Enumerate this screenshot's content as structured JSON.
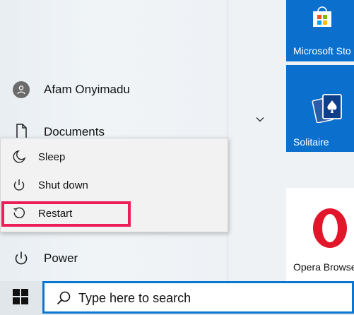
{
  "user": {
    "name": "Afam Onyimadu"
  },
  "menu": {
    "documents_label": "Documents",
    "power_label": "Power"
  },
  "power_menu": {
    "items": [
      {
        "label": "Sleep",
        "icon": "moon-icon"
      },
      {
        "label": "Shut down",
        "icon": "power-icon"
      },
      {
        "label": "Restart",
        "icon": "restart-icon"
      }
    ],
    "highlighted": "Restart",
    "highlight_color": "#ec1e5a"
  },
  "tiles": [
    {
      "label": "Microsoft Sto",
      "icon": "store-icon",
      "color": "#0b6fce"
    },
    {
      "label": "Solitaire",
      "icon": "cards-icon",
      "color": "#0b6fce"
    },
    {
      "label": "Opera Browse",
      "icon": "opera-icon",
      "color": "#ffffff"
    }
  ],
  "taskbar": {
    "search_placeholder": "Type here to search",
    "accent": "#0a76d2"
  }
}
